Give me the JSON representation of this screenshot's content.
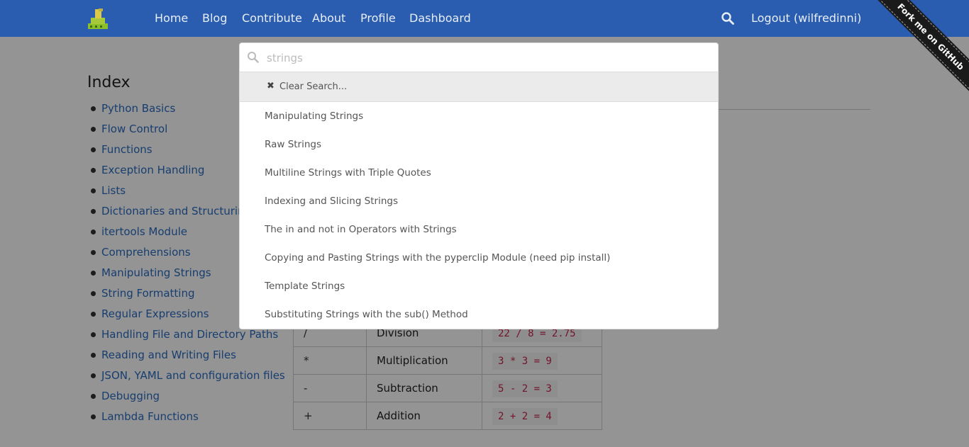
{
  "navbar": {
    "links": [
      "Home",
      "Blog",
      "Contribute",
      "About",
      "Profile",
      "Dashboard"
    ],
    "logout": "Logout (wilfredinni)",
    "search_icon": "search-icon"
  },
  "ribbon": {
    "text": "Fork me on GitHub"
  },
  "sidebar": {
    "title": "Index",
    "items": [
      "Python Basics",
      "Flow Control",
      "Functions",
      "Exception Handling",
      "Lists",
      "Dictionaries and Structuring Data",
      "itertools Module",
      "Comprehensions",
      "Manipulating Strings",
      "String Formatting",
      "Regular Expressions",
      "Handling File and Directory Paths",
      "Reading and Writing Files",
      "JSON, YAML and configuration files",
      "Debugging",
      "Lambda Functions"
    ]
  },
  "operators_table": {
    "rows": [
      {
        "op": "/",
        "name": "Division",
        "example": "22 / 8 = 2.75"
      },
      {
        "op": "*",
        "name": "Multiplication",
        "example": "3 * 3 = 9"
      },
      {
        "op": "-",
        "name": "Subtraction",
        "example": "5 - 2 = 3"
      },
      {
        "op": "+",
        "name": "Addition",
        "example": "2 + 2 = 4"
      }
    ]
  },
  "search": {
    "query": "strings",
    "clear_label": "Clear Search...",
    "results": [
      "Manipulating Strings",
      "Raw Strings",
      "Multiline Strings with Triple Quotes",
      "Indexing and Slicing Strings",
      "The in and not in Operators with Strings",
      "Copying and Pasting Strings with the pyperclip Module (need pip install)",
      "Template Strings",
      "Substituting Strings with the sub() Method"
    ]
  },
  "colors": {
    "navbar": "#2a5db0",
    "link": "#2a6bbf",
    "code": "#c7254e"
  }
}
